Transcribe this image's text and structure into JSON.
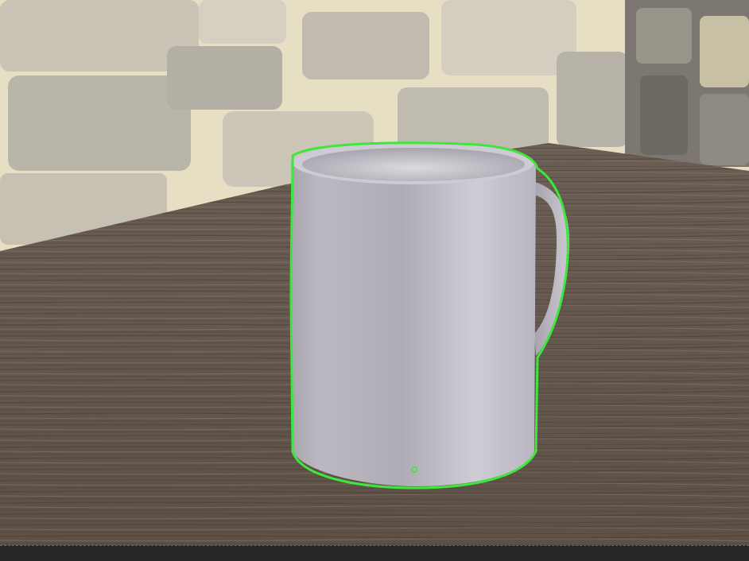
{
  "viewport": {
    "type": "3d-viewport-render",
    "object_selected": true,
    "selection_outline_color": "#3ee63e",
    "origin_point_color": "#3ee63e"
  },
  "scene": {
    "background": "stone-wall",
    "surface": "wood-table",
    "object": "mug",
    "colors": {
      "stone_light": "#d8d2c2",
      "stone_mid": "#9d9a90",
      "mortar": "#ece3c4",
      "wood_dark": "#514438",
      "wood_light": "#8a7c70",
      "mug_body": "#c9c6cf"
    }
  }
}
